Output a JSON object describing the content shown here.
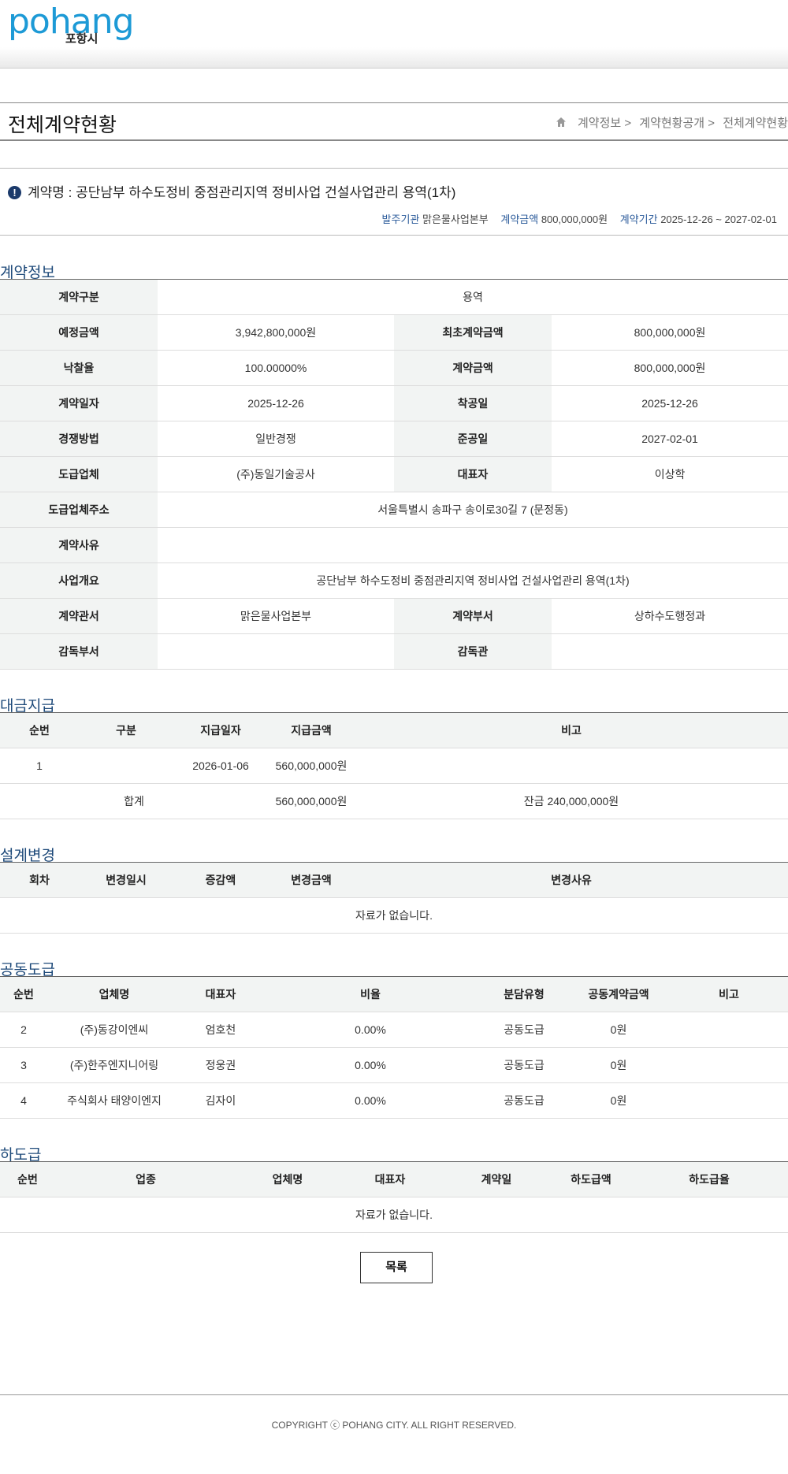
{
  "header": {
    "logo_text": "pohang",
    "logo_sub": "포항시"
  },
  "page": {
    "title": "전체계약현황",
    "breadcrumb": [
      "계약정보 >",
      "계약현황공개 >",
      "전체계약현황"
    ]
  },
  "contract": {
    "name": "계약명 : 공단남부 하수도정비 중점관리지역 정비사업 건설사업관리 용역(1차)",
    "alert_icon": "!",
    "meta": {
      "agency_label": "발주기관",
      "agency": "맑은물사업본부",
      "amount_label": "계약금액",
      "amount": "800,000,000원",
      "period_label": "계약기간",
      "period": "2025-12-26 ~ 2027-02-01"
    }
  },
  "info": {
    "title": "계약정보",
    "rows": [
      {
        "l1": "계약구분",
        "v1": "용역"
      },
      {
        "l1": "예정금액",
        "v1": "3,942,800,000원",
        "l2": "최초계약금액",
        "v2": "800,000,000원"
      },
      {
        "l1": "낙찰율",
        "v1": "100.00000%",
        "l2": "계약금액",
        "v2": "800,000,000원"
      },
      {
        "l1": "계약일자",
        "v1": "2025-12-26",
        "l2": "착공일",
        "v2": "2025-12-26"
      },
      {
        "l1": "경쟁방법",
        "v1": "일반경쟁",
        "l2": "준공일",
        "v2": "2027-02-01"
      },
      {
        "l1": "도급업체",
        "v1": "(주)동일기술공사",
        "l2": "대표자",
        "v2": "이상학"
      },
      {
        "l1": "도급업체주소",
        "v1": "서울특별시 송파구 송이로30길 7 (문정동)"
      },
      {
        "l1": "계약사유",
        "v1": ""
      },
      {
        "l1": "사업개요",
        "v1": "공단남부 하수도정비 중점관리지역 정비사업 건설사업관리 용역(1차)"
      },
      {
        "l1": "계약관서",
        "v1": "맑은물사업본부",
        "l2": "계약부서",
        "v2": "상하수도행정과"
      },
      {
        "l1": "감독부서",
        "v1": "",
        "l2": "감독관",
        "v2": ""
      }
    ]
  },
  "payment": {
    "title": "대금지급",
    "headers": [
      "순번",
      "구분",
      "지급일자",
      "지급금액",
      "비고"
    ],
    "rows": [
      [
        "1",
        "",
        "2026-01-06",
        "560,000,000원",
        ""
      ]
    ],
    "total": {
      "label": "합계",
      "amount": "560,000,000원",
      "note": "잔금 240,000,000원"
    }
  },
  "design": {
    "title": "설계변경",
    "headers": [
      "회차",
      "변경일시",
      "증감액",
      "변경금액",
      "변경사유"
    ],
    "empty": "자료가 없습니다."
  },
  "joint": {
    "title": "공동도급",
    "headers": [
      "순번",
      "업체명",
      "대표자",
      "비율",
      "분담유형",
      "공동계약금액",
      "비고"
    ],
    "rows": [
      [
        "2",
        "(주)동강이엔씨",
        "엄호천",
        "0.00%",
        "공동도급",
        "0원",
        ""
      ],
      [
        "3",
        "(주)한주엔지니어링",
        "정웅권",
        "0.00%",
        "공동도급",
        "0원",
        ""
      ],
      [
        "4",
        "주식회사 태양이엔지",
        "김자이",
        "0.00%",
        "공동도급",
        "0원",
        ""
      ]
    ]
  },
  "sub": {
    "title": "하도급",
    "headers": [
      "순번",
      "업종",
      "업체명",
      "대표자",
      "계약일",
      "하도급액",
      "하도급율"
    ],
    "empty": "자료가 없습니다."
  },
  "buttons": {
    "list": "목록"
  },
  "footer": {
    "copyright": "COPYRIGHT ⓒ POHANG CITY. ALL RIGHT RESERVED."
  }
}
